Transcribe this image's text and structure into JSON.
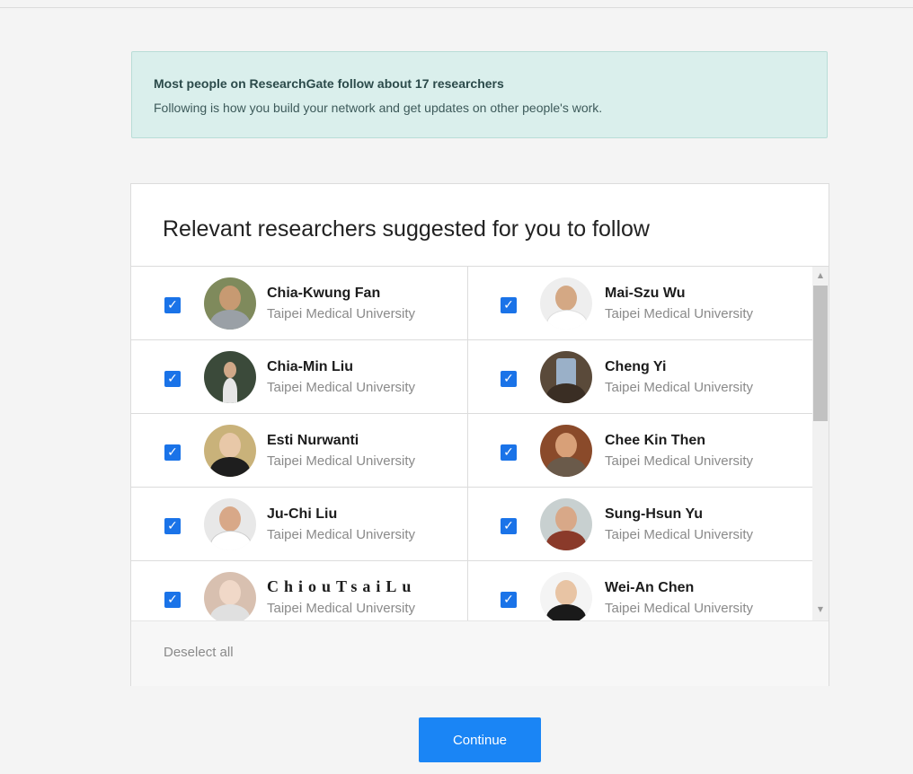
{
  "banner": {
    "title": "Most people on ResearchGate follow about 17 researchers",
    "text": "Following is how you build your network and get updates on other people's work."
  },
  "card": {
    "title": "Relevant researchers suggested for you to follow",
    "deselect_label": "Deselect all"
  },
  "researchers": [
    {
      "name": "Chia-Kwung Fan",
      "affiliation": "Taipei Medical University",
      "checked": true
    },
    {
      "name": "Mai-Szu Wu",
      "affiliation": "Taipei Medical University",
      "checked": true
    },
    {
      "name": "Chia-Min Liu",
      "affiliation": "Taipei Medical University",
      "checked": true
    },
    {
      "name": "Cheng Yi",
      "affiliation": "Taipei Medical University",
      "checked": true
    },
    {
      "name": "Esti Nurwanti",
      "affiliation": "Taipei Medical University",
      "checked": true
    },
    {
      "name": "Chee Kin Then",
      "affiliation": "Taipei Medical University",
      "checked": true
    },
    {
      "name": "Ju-Chi Liu",
      "affiliation": "Taipei Medical University",
      "checked": true
    },
    {
      "name": "Sung-Hsun Yu",
      "affiliation": "Taipei Medical University",
      "checked": true
    },
    {
      "name": "ChiouTsaiLu",
      "affiliation": "Taipei Medical University",
      "checked": true
    },
    {
      "name": "Wei-An Chen",
      "affiliation": "Taipei Medical University",
      "checked": true
    }
  ],
  "icons": {
    "checkbox": "check-icon",
    "scroll_up": "arrow-up-icon",
    "scroll_down": "arrow-down-icon"
  },
  "colors": {
    "accent": "#1a85f5",
    "checkbox": "#1a73e8",
    "banner_bg": "#daefec"
  },
  "continue_label": "Continue"
}
